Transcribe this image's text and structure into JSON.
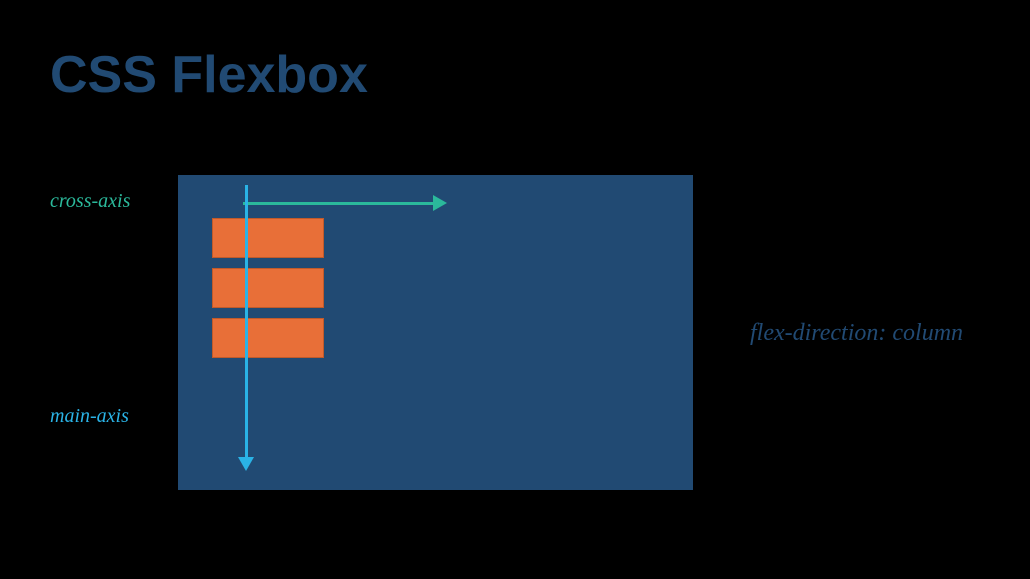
{
  "title": "CSS Flexbox",
  "labels": {
    "cross_axis": "cross-axis",
    "main_axis": "main-axis",
    "flex_direction": "flex-direction: column"
  },
  "diagram": {
    "container_color": "#214a73",
    "item_color": "#e86f38",
    "cross_axis_color": "#2bb99b",
    "main_axis_color": "#2ab3e6",
    "flex_direction_value": "column",
    "item_count": 3
  }
}
